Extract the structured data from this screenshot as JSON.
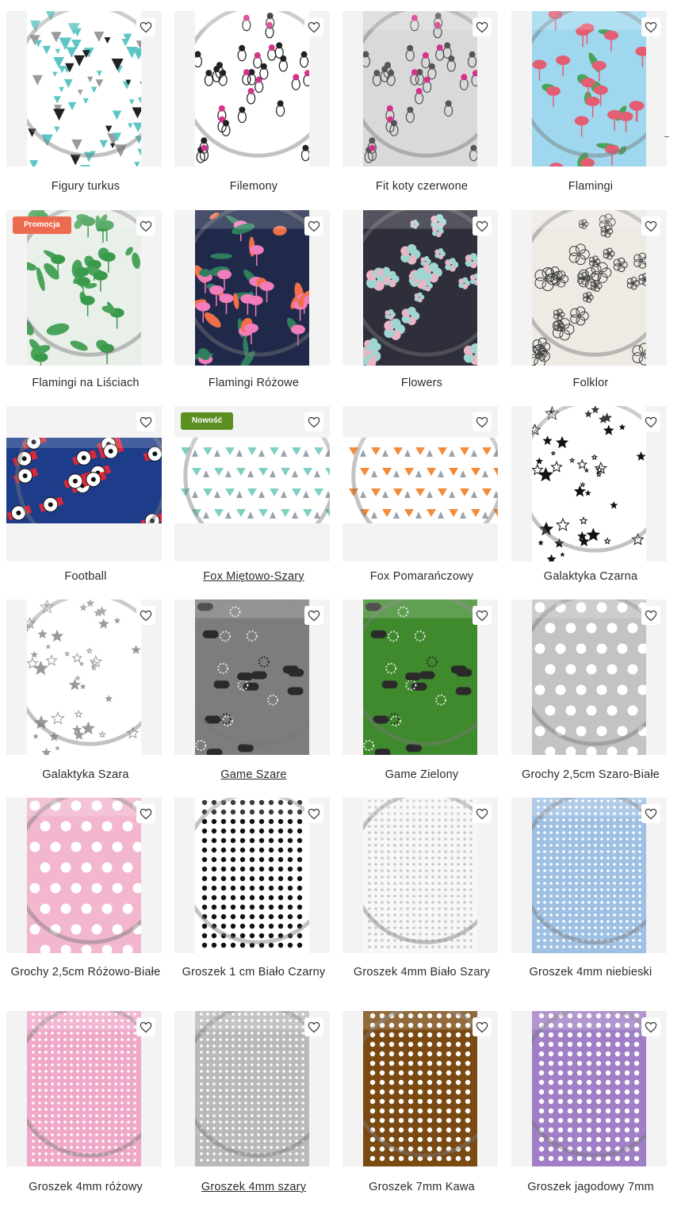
{
  "products": [
    {
      "name": "Figury turkus",
      "bg": "#ffffff",
      "fg": "#5cc6c4",
      "pattern": "triangles",
      "link": false
    },
    {
      "name": "Filemony",
      "bg": "#ffffff",
      "fg": "#222222",
      "pattern": "cats",
      "link": false
    },
    {
      "name": "Fit koty czerwone",
      "bg": "#d9d9d9",
      "fg": "#555555",
      "pattern": "cats",
      "link": false
    },
    {
      "name": "Flamingi",
      "bg": "#9fd8ee",
      "fg": "#e35d73",
      "pattern": "flamingo",
      "link": false
    },
    {
      "name": "Flamingi na Liściach",
      "bg": "#e9efe9",
      "fg": "#3a9a4c",
      "pattern": "leaves",
      "link": false,
      "badge": "Promocja",
      "badge_color": "#ec6a4f"
    },
    {
      "name": "Flamingi Różowe",
      "bg": "#20294a",
      "fg": "#f27dbb",
      "pattern": "tropical",
      "link": false
    },
    {
      "name": "Flowers",
      "bg": "#2e2f3b",
      "fg": "#9fd6d1",
      "pattern": "flowers",
      "link": false
    },
    {
      "name": "Folklor",
      "bg": "#eeebe4",
      "fg": "#3b3b3b",
      "pattern": "folk",
      "link": false
    },
    {
      "name": "Football",
      "bg": "#1d3c8a",
      "fg": "#ffffff",
      "pattern": "football",
      "link": false
    },
    {
      "name": "Fox Miętowo-Szary",
      "bg": "#ffffff",
      "fg": "#7fcfc3",
      "pattern": "fox",
      "link": true,
      "badge": "Nowość",
      "badge_color": "#5c8f22"
    },
    {
      "name": "Fox Pomarańczowy",
      "bg": "#ffffff",
      "fg": "#f28b3a",
      "pattern": "fox",
      "link": false
    },
    {
      "name": "Galaktyka Czarna",
      "bg": "#ffffff",
      "fg": "#111111",
      "pattern": "stars",
      "link": false
    },
    {
      "name": "Galaktyka Szara",
      "bg": "#ffffff",
      "fg": "#9a9a9a",
      "pattern": "stars",
      "link": false
    },
    {
      "name": "Game Szare",
      "bg": "#7d7d7d",
      "fg": "#2a2a2a",
      "pattern": "game",
      "link": true
    },
    {
      "name": "Game Zielony",
      "bg": "#3f8a2c",
      "fg": "#2a2a2a",
      "pattern": "game",
      "link": false
    },
    {
      "name": "Grochy 2,5cm Szaro-Białe",
      "bg": "#c3c3c3",
      "fg": "#ffffff",
      "pattern": "bigdots",
      "link": false
    },
    {
      "name": "Grochy 2,5cm Różowo-Białe",
      "bg": "#f2b6cf",
      "fg": "#ffffff",
      "pattern": "bigdots",
      "link": false
    },
    {
      "name": "Groszek 1 cm Biało Czarny",
      "bg": "#ffffff",
      "fg": "#111111",
      "pattern": "dots",
      "link": false
    },
    {
      "name": "Groszek 4mm Biało Szary",
      "bg": "#f7f7f7",
      "fg": "#c8c8c8",
      "pattern": "tinydots",
      "link": false
    },
    {
      "name": "Groszek 4mm niebieski",
      "bg": "#9ec0e3",
      "fg": "#ffffff",
      "pattern": "tinydots",
      "link": false
    },
    {
      "name": "Groszek 4mm różowy",
      "bg": "#f0a8c9",
      "fg": "#ffffff",
      "pattern": "tinydots",
      "link": false
    },
    {
      "name": "Groszek 4mm szary",
      "bg": "#b9b9b9",
      "fg": "#ffffff",
      "pattern": "tinydots",
      "link": true
    },
    {
      "name": "Groszek 7mm Kawa",
      "bg": "#7a4a12",
      "fg": "#ffffff",
      "pattern": "dots",
      "link": false
    },
    {
      "name": "Groszek jagodowy 7mm",
      "bg": "#a07fc6",
      "fg": "#ffffff",
      "pattern": "dots",
      "link": false
    }
  ],
  "icons": {
    "favorite": "heart-outline-icon"
  }
}
